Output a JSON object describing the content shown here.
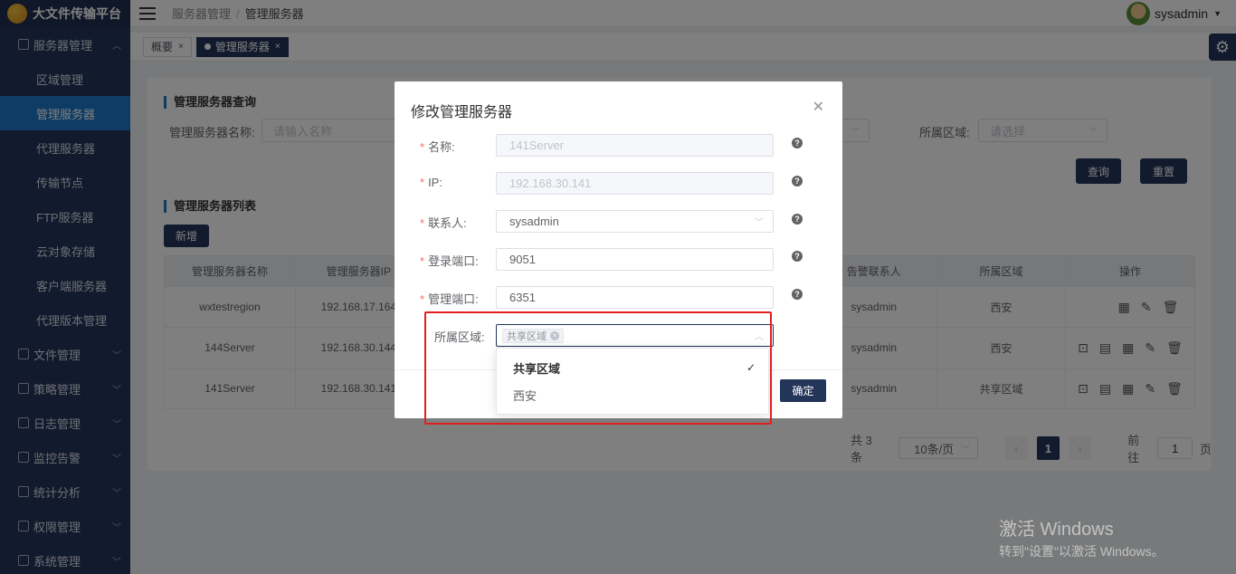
{
  "app": {
    "title": "大文件传输平台"
  },
  "sidebar": {
    "groups": [
      {
        "label": "服务器管理",
        "expanded": true,
        "items": [
          "区域管理",
          "管理服务器",
          "代理服务器",
          "传输节点",
          "FTP服务器",
          "云对象存储",
          "客户端服务器",
          "代理版本管理"
        ],
        "active": "管理服务器"
      },
      {
        "label": "文件管理"
      },
      {
        "label": "策略管理"
      },
      {
        "label": "日志管理"
      },
      {
        "label": "监控告警"
      },
      {
        "label": "统计分析"
      },
      {
        "label": "权限管理"
      },
      {
        "label": "系统管理"
      }
    ]
  },
  "header": {
    "breadcrumb": [
      "服务器管理",
      "管理服务器"
    ],
    "user": "sysadmin"
  },
  "tabs": [
    {
      "label": "概要"
    },
    {
      "label": "管理服务器",
      "active": true
    }
  ],
  "query": {
    "title": "管理服务器查询",
    "name_label": "管理服务器名称:",
    "name_placeholder": "请输入名称",
    "region_label": "所属区域:",
    "region_placeholder": "请选择",
    "search_btn": "查询",
    "reset_btn": "重置"
  },
  "list": {
    "title": "管理服务器列表",
    "add_btn": "新增",
    "columns": [
      "管理服务器名称",
      "管理服务器IP",
      "告警联系人",
      "所属区域",
      "操作"
    ],
    "rows": [
      {
        "name": "wxtestregion",
        "ip": "192.168.17.164",
        "contact": "sysadmin",
        "region": "西安"
      },
      {
        "name": "144Server",
        "ip": "192.168.30.144",
        "contact": "sysadmin",
        "region": "西安"
      },
      {
        "name": "141Server",
        "ip": "192.168.30.141",
        "contact": "sysadmin",
        "region": "共享区域"
      }
    ]
  },
  "pager": {
    "total": "共 3 条",
    "page_size": "10条/页",
    "current": "1",
    "goto_label": "前往",
    "goto_value": "1",
    "page_unit": "页"
  },
  "dialog": {
    "title": "修改管理服务器",
    "fields": {
      "name": {
        "label": "名称:",
        "value": "141Server"
      },
      "ip": {
        "label": "IP:",
        "value": "192.168.30.141"
      },
      "contact": {
        "label": "联系人:",
        "value": "sysadmin"
      },
      "login_port": {
        "label": "登录端口:",
        "value": "9051"
      },
      "mgmt_port": {
        "label": "管理端口:",
        "value": "6351"
      },
      "region": {
        "label": "所属区域:",
        "tag": "共享区域"
      }
    },
    "confirm_btn": "确定",
    "dropdown_options": [
      {
        "label": "共享区域",
        "selected": true
      },
      {
        "label": "西安",
        "selected": false
      }
    ]
  },
  "watermark": {
    "line1": "激活 Windows",
    "line2": "转到\"设置\"以激活 Windows。"
  },
  "colors": {
    "sidebar": "#24355a",
    "active": "#1c78c9",
    "primary_btn": "#24355a",
    "highlight": "#e02020"
  }
}
